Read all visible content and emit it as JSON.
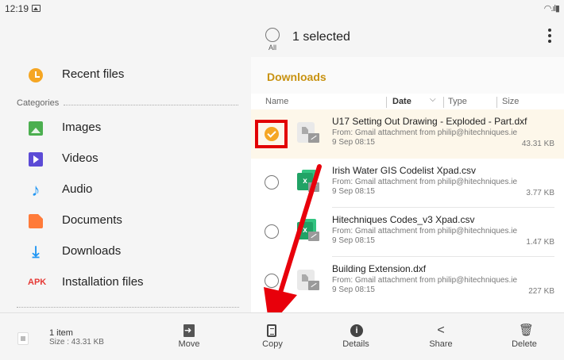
{
  "status_bar": {
    "time": "12:19",
    "signal": "◠.ıl▮"
  },
  "sidebar": {
    "recent": {
      "label": "Recent files",
      "icon": "clock-icon"
    },
    "categories_label": "Categories",
    "items": [
      {
        "label": "Images",
        "icon": "image-icon"
      },
      {
        "label": "Videos",
        "icon": "video-icon"
      },
      {
        "label": "Audio",
        "icon": "music-note-icon"
      },
      {
        "label": "Documents",
        "icon": "document-icon"
      },
      {
        "label": "Downloads",
        "icon": "download-icon"
      },
      {
        "label": "Installation files",
        "icon": "apk-icon",
        "badge": "APK"
      }
    ]
  },
  "selection": {
    "all_label": "All",
    "count_text": "1 selected"
  },
  "folder": {
    "title": "Downloads"
  },
  "columns": {
    "name": "Name",
    "date": "Date",
    "type": "Type",
    "size": "Size"
  },
  "files": [
    {
      "name": "U17 Setting Out Drawing - Exploded - Part.dxf",
      "from": "From: Gmail attachment from philip@hitechniques.ie",
      "date": "9 Sep 08:15",
      "size": "43.31 KB",
      "selected": true,
      "icon": "generic-file-icon"
    },
    {
      "name": "Irish Water GIS Codelist Xpad.csv",
      "from": "From: Gmail attachment from philip@hitechniques.ie",
      "date": "9 Sep 08:15",
      "size": "3.77 KB",
      "selected": false,
      "icon": "excel-icon"
    },
    {
      "name": "Hitechniques Codes_v3 Xpad.csv",
      "from": "From: Gmail attachment from philip@hitechniques.ie",
      "date": "9 Sep 08:15",
      "size": "1.47 KB",
      "selected": false,
      "icon": "excel-icon"
    },
    {
      "name": "Building Extension.dxf",
      "from": "From: Gmail attachment from philip@hitechniques.ie",
      "date": "9 Sep 08:15",
      "size": "227 KB",
      "selected": false,
      "icon": "generic-file-icon"
    }
  ],
  "bottom": {
    "count": "1 item",
    "size": "Size : 43.31 KB",
    "actions": {
      "move": "Move",
      "copy": "Copy",
      "details": "Details",
      "share": "Share",
      "delete": "Delete"
    }
  },
  "colors": {
    "accent": "#f5a623",
    "folder_title": "#c89211",
    "highlight": "#e20000",
    "selected_row": "#fdf7ea"
  }
}
